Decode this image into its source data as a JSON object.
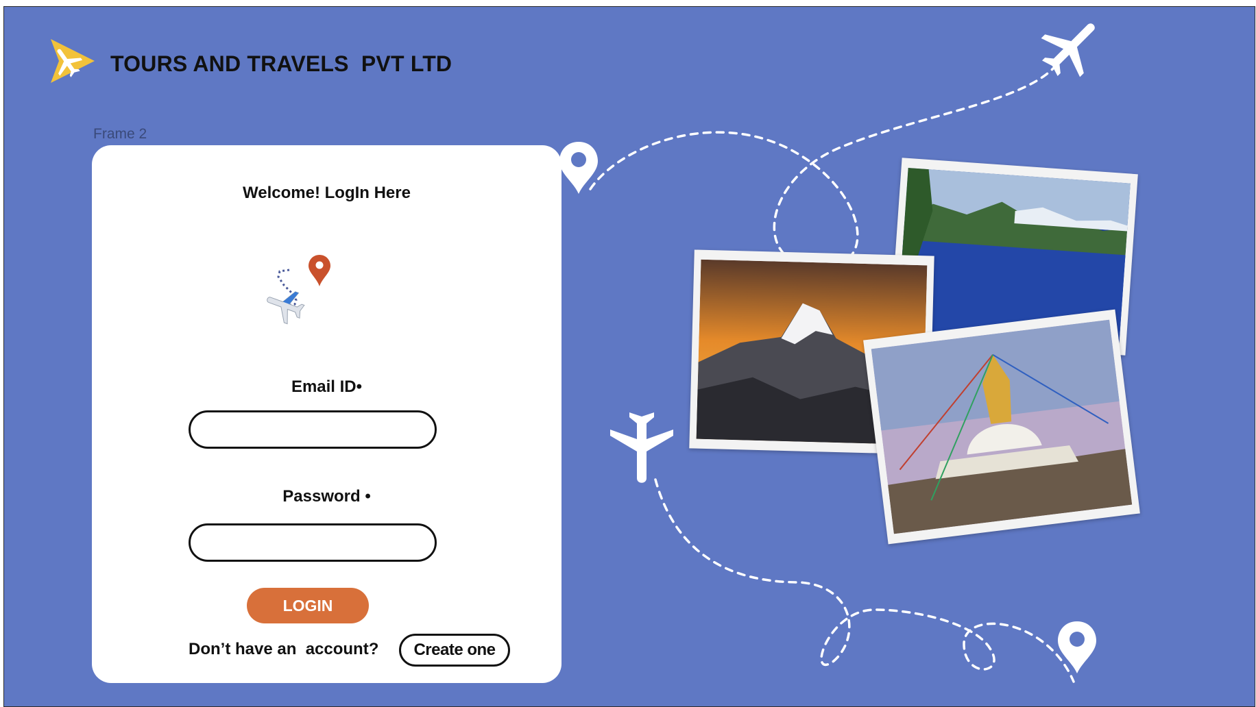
{
  "header": {
    "brand_name": "TOURS AND TRAVELS  PVT LTD",
    "logo_icon": "plane-arrow-logo-icon"
  },
  "frame_label": "Frame 2",
  "login_card": {
    "title": "Welcome! LogIn Here",
    "hero_icon": "plane-route-pin-icon",
    "email_label": "Email  ID•",
    "email_value": "",
    "password_label": "Password •",
    "password_value": "",
    "login_button": "LOGIN",
    "no_account_text": "Don’t have an  account?",
    "create_button": "Create one"
  },
  "decorations": {
    "icons": [
      "airplane-icon",
      "location-pin-icon",
      "dashed-flight-path"
    ],
    "photos": [
      "mountain-sunset-photo",
      "lake-photo",
      "stupa-photo"
    ]
  },
  "colors": {
    "background": "#5f78c4",
    "accent": "#d8703a",
    "logo_yellow": "#f2c23a",
    "card": "#ffffff"
  }
}
